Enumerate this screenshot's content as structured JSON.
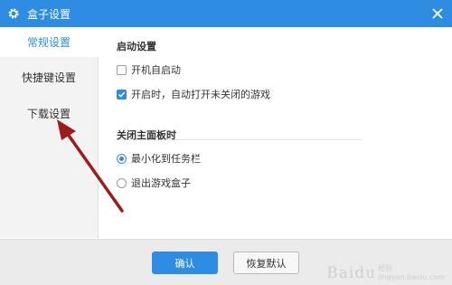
{
  "window": {
    "title": "盒子设置",
    "icon": "gear-icon",
    "close_icon": "close-icon"
  },
  "sidebar": {
    "items": [
      {
        "label": "常规设置",
        "active": true
      },
      {
        "label": "快捷键设置",
        "active": false
      },
      {
        "label": "下载设置",
        "active": false
      }
    ]
  },
  "startup": {
    "title": "启动设置",
    "options": [
      {
        "label": "开机自启动",
        "checked": false
      },
      {
        "label": "开启时，自动打开未关闭的游戏",
        "checked": true
      }
    ]
  },
  "close_main_panel": {
    "title": "关闭主面板时",
    "options": [
      {
        "label": "最小化到任务栏",
        "selected": true
      },
      {
        "label": "退出游戏盒子",
        "selected": false
      }
    ]
  },
  "footer": {
    "confirm_label": "确认",
    "reset_label": "恢复默认"
  },
  "watermark": {
    "main": "Baidu",
    "sub_line1": "经验",
    "sub_line2": "jingyan.baidu.com"
  },
  "colors": {
    "accent": "#2e8de2",
    "arrow": "#9b1c1c",
    "sidebar_bg": "#f3f3f3",
    "footer_bg": "#ebebeb"
  }
}
